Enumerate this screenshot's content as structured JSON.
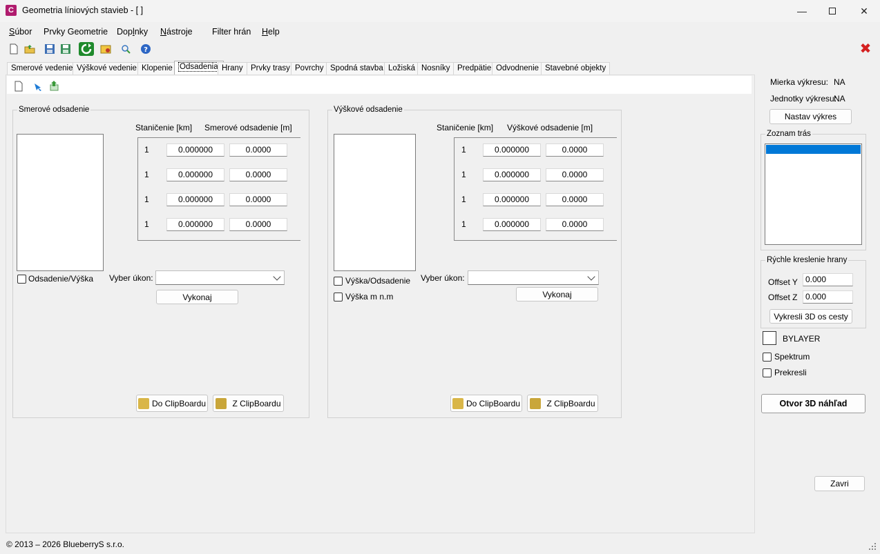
{
  "window": {
    "title": "Geometria líniových stavieb - [ ]",
    "icon_letter": "C"
  },
  "menu": [
    {
      "pre": "",
      "ul": "S",
      "post": "úbor"
    },
    {
      "pre": "",
      "ul": "",
      "post": "Prvky Geometrie"
    },
    {
      "pre": "Dop",
      "ul": "l",
      "post": "nky"
    },
    {
      "pre": "",
      "ul": "N",
      "post": "ástroje"
    },
    {
      "pre": "",
      "ul": "",
      "post": "Filter hrán"
    },
    {
      "pre": "",
      "ul": "H",
      "post": "elp"
    }
  ],
  "tabs": [
    "Smerové vedenie",
    "Výškové vedenie",
    "Klopenie",
    "Odsadenia",
    "Hrany",
    "Prvky trasy",
    "Povrchy",
    "Spodná stavba",
    "Ložiská",
    "Nosníky",
    "Predpätie",
    "Odvodnenie",
    "Stavebné objekty"
  ],
  "active_tab": "Odsadenia",
  "left_group": {
    "title": "Smerové odsadenie",
    "col1": "Staničenie [km]",
    "col2": "Smerové odsadenie [m]",
    "rows": [
      {
        "n": "1",
        "station": "0.000000",
        "offset": "0.0000"
      },
      {
        "n": "1",
        "station": "0.000000",
        "offset": "0.0000"
      },
      {
        "n": "1",
        "station": "0.000000",
        "offset": "0.0000"
      },
      {
        "n": "1",
        "station": "0.000000",
        "offset": "0.0000"
      }
    ],
    "checkbox_label": "Odsadenie/Výška",
    "action_label": "Vyber úkon:",
    "action_value": "",
    "execute": "Vykonaj",
    "to_clip": "Do ClipBoardu",
    "from_clip": "Z ClipBoardu"
  },
  "right_group": {
    "title": "Výškové odsadenie",
    "col1": "Staničenie [km]",
    "col2": "Výškové odsadenie [m]",
    "rows": [
      {
        "n": "1",
        "station": "0.000000",
        "offset": "0.0000"
      },
      {
        "n": "1",
        "station": "0.000000",
        "offset": "0.0000"
      },
      {
        "n": "1",
        "station": "0.000000",
        "offset": "0.0000"
      },
      {
        "n": "1",
        "station": "0.000000",
        "offset": "0.0000"
      }
    ],
    "checkbox1_label": "Výška/Odsadenie",
    "checkbox2_label": "Výška m n.m",
    "action_label": "Vyber úkon:",
    "action_value": "",
    "execute": "Vykonaj",
    "to_clip": "Do ClipBoardu",
    "from_clip": "Z ClipBoardu"
  },
  "side": {
    "scale_label": "Mierka výkresu:",
    "scale_value": "NA",
    "units_label": "Jednotky výkresu:",
    "units_value": "NA",
    "set_drawing": "Nastav výkres",
    "routes_title": "Zoznam trás",
    "quick_title": "Rýchle kreslenie hrany",
    "offset_y_label": "Offset Y",
    "offset_y": "0.000",
    "offset_z_label": "Offset Z",
    "offset_z": "0.000",
    "draw3d": "Vykresli 3D os cesty",
    "layer": "BYLAYER",
    "spectrum": "Spektrum",
    "redraw": "Prekresli",
    "open3d": "Otvor 3D náhľad",
    "close": "Zavri"
  },
  "status": "© 2013 – 2026 BlueberryS s.r.o.",
  "colors": {
    "accent": "#0078d7",
    "close_red": "#d42020",
    "app_icon": "#b01c6e"
  }
}
